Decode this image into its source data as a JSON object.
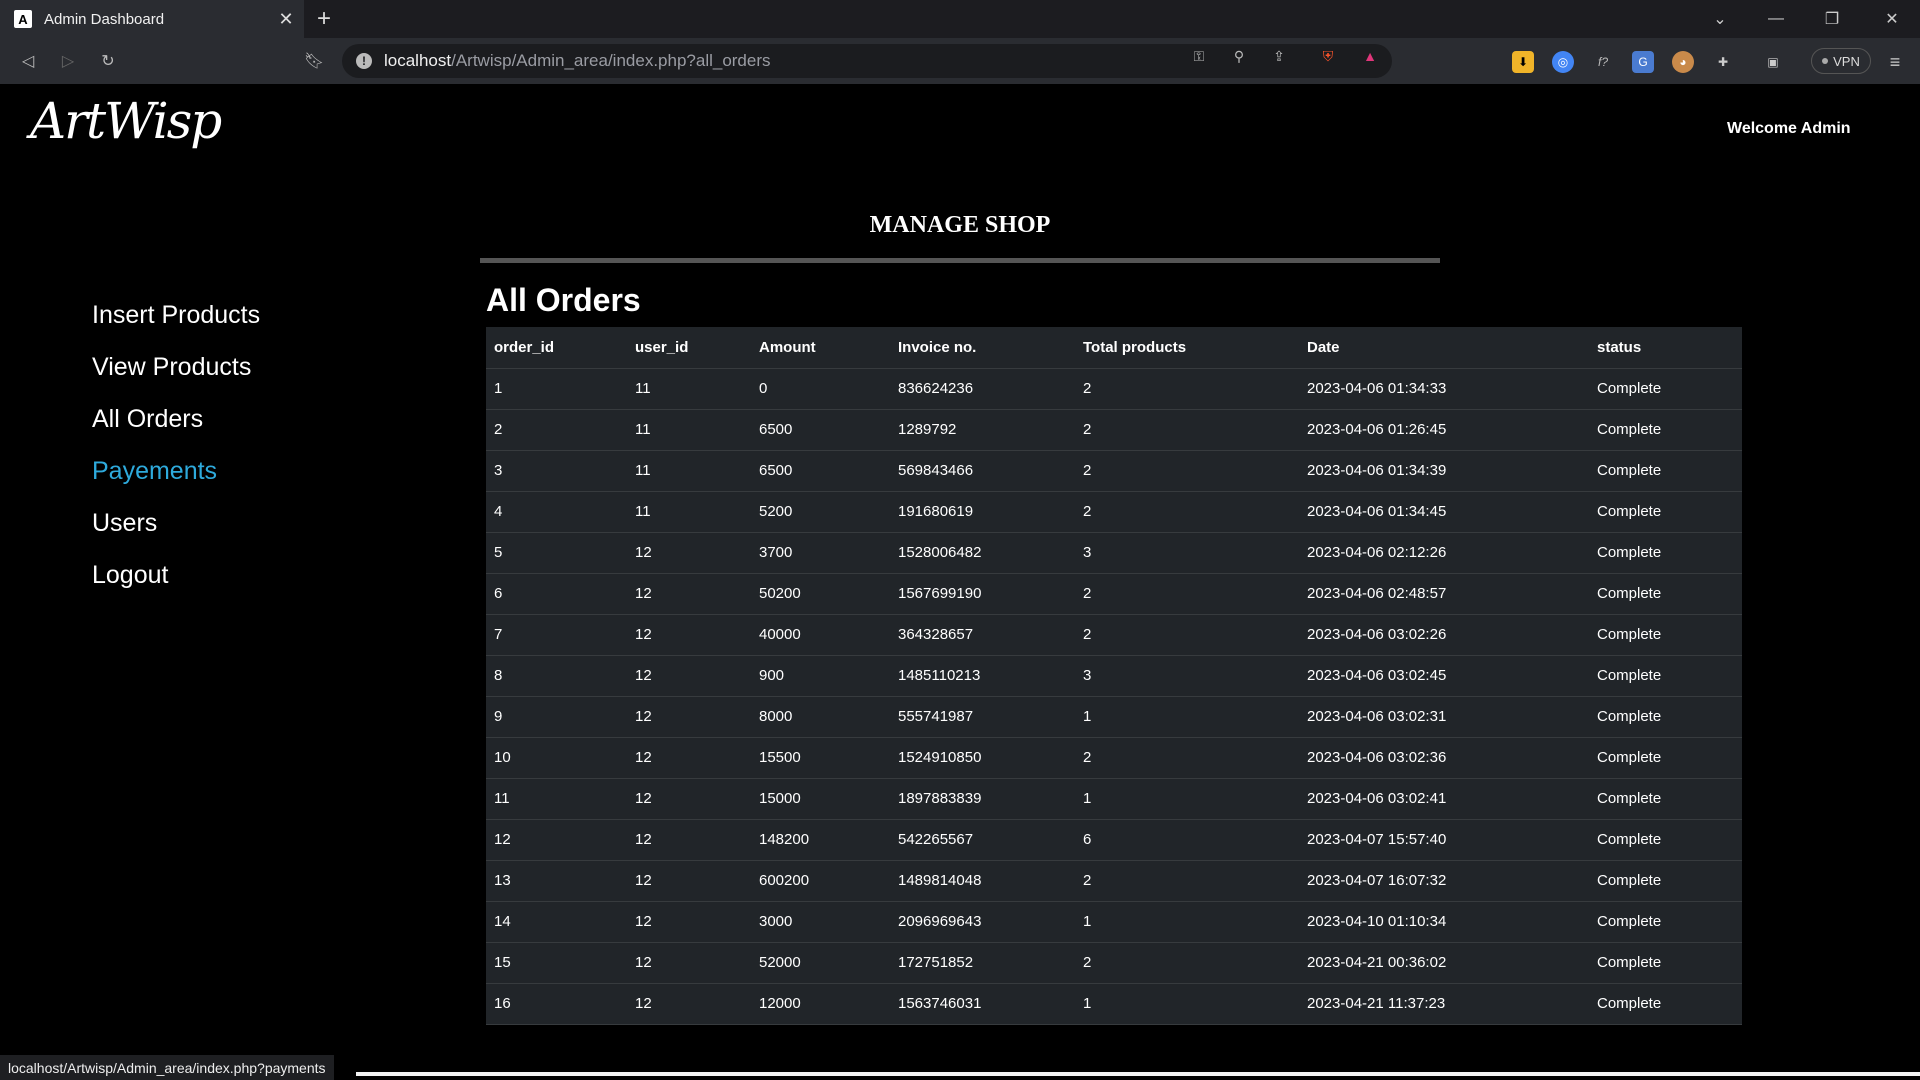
{
  "browser": {
    "tab_title": "Admin Dashboard",
    "favicon_letter": "A",
    "url_host": "localhost",
    "url_path": "/Artwisp/Admin_area/index.php?all_orders",
    "vpn_label": "VPN",
    "status_url": "localhost/Artwisp/Admin_area/index.php?payments"
  },
  "header": {
    "logo_text": "ArtWisp",
    "welcome": "Welcome Admin"
  },
  "page": {
    "heading": "MANAGE SHOP",
    "section_title": "All Orders"
  },
  "sidebar": {
    "items": [
      {
        "label": "Insert Products",
        "active": false
      },
      {
        "label": "View Products",
        "active": false
      },
      {
        "label": "All Orders",
        "active": false
      },
      {
        "label": "Payements",
        "active": true
      },
      {
        "label": "Users",
        "active": false
      },
      {
        "label": "Logout",
        "active": false
      }
    ]
  },
  "table": {
    "columns": [
      "order_id",
      "user_id",
      "Amount",
      "Invoice no.",
      "Total products",
      "Date",
      "status"
    ],
    "rows": [
      [
        "1",
        "11",
        "0",
        "836624236",
        "2",
        "2023-04-06 01:34:33",
        "Complete"
      ],
      [
        "2",
        "11",
        "6500",
        "1289792",
        "2",
        "2023-04-06 01:26:45",
        "Complete"
      ],
      [
        "3",
        "11",
        "6500",
        "569843466",
        "2",
        "2023-04-06 01:34:39",
        "Complete"
      ],
      [
        "4",
        "11",
        "5200",
        "191680619",
        "2",
        "2023-04-06 01:34:45",
        "Complete"
      ],
      [
        "5",
        "12",
        "3700",
        "1528006482",
        "3",
        "2023-04-06 02:12:26",
        "Complete"
      ],
      [
        "6",
        "12",
        "50200",
        "1567699190",
        "2",
        "2023-04-06 02:48:57",
        "Complete"
      ],
      [
        "7",
        "12",
        "40000",
        "364328657",
        "2",
        "2023-04-06 03:02:26",
        "Complete"
      ],
      [
        "8",
        "12",
        "900",
        "1485110213",
        "3",
        "2023-04-06 03:02:45",
        "Complete"
      ],
      [
        "9",
        "12",
        "8000",
        "555741987",
        "1",
        "2023-04-06 03:02:31",
        "Complete"
      ],
      [
        "10",
        "12",
        "15500",
        "1524910850",
        "2",
        "2023-04-06 03:02:36",
        "Complete"
      ],
      [
        "11",
        "12",
        "15000",
        "1897883839",
        "1",
        "2023-04-06 03:02:41",
        "Complete"
      ],
      [
        "12",
        "12",
        "148200",
        "542265567",
        "6",
        "2023-04-07 15:57:40",
        "Complete"
      ],
      [
        "13",
        "12",
        "600200",
        "1489814048",
        "2",
        "2023-04-07 16:07:32",
        "Complete"
      ],
      [
        "14",
        "12",
        "3000",
        "2096969643",
        "1",
        "2023-04-10 01:10:34",
        "Complete"
      ],
      [
        "15",
        "12",
        "52000",
        "172751852",
        "2",
        "2023-04-21 00:36:02",
        "Complete"
      ],
      [
        "16",
        "12",
        "12000",
        "1563746031",
        "1",
        "2023-04-21 11:37:23",
        "Complete"
      ]
    ]
  },
  "colors": {
    "active_link": "#2eaadc",
    "table_bg": "#212529"
  }
}
